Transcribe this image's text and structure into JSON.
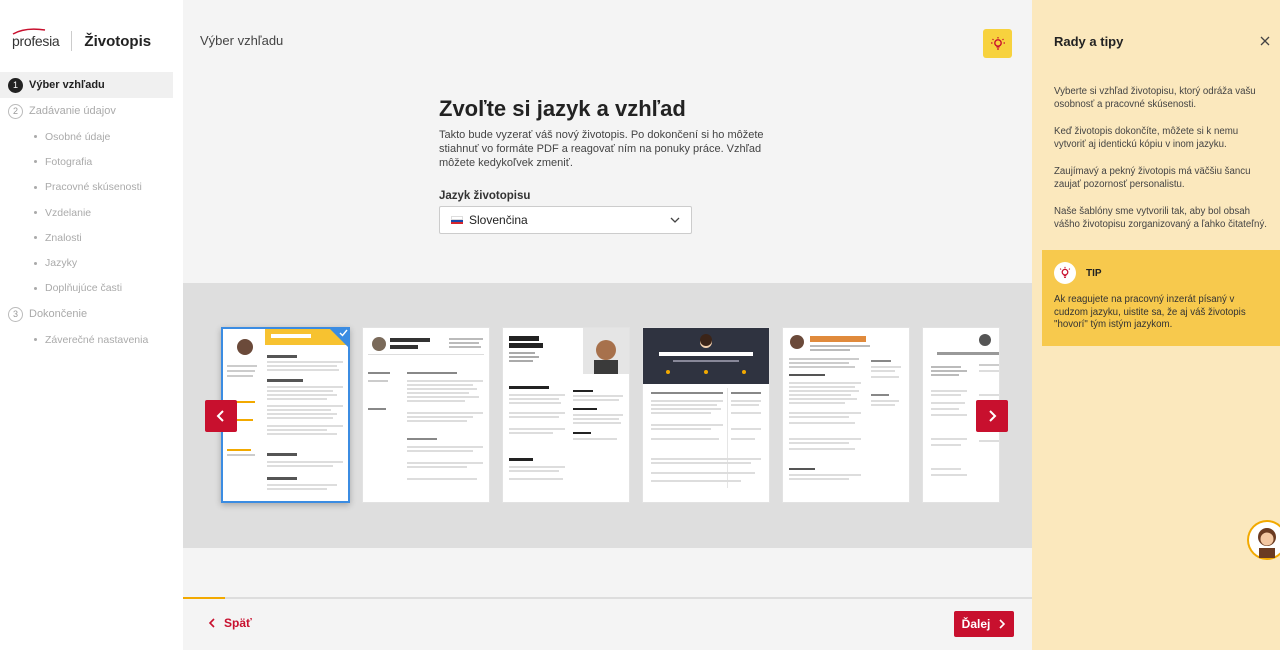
{
  "brand": {
    "logo_text": "profesia",
    "product": "Životopis"
  },
  "sidebar": {
    "steps": [
      {
        "num": "1",
        "label": "Výber vzhľadu",
        "active": true
      },
      {
        "num": "2",
        "label": "Zadávanie údajov",
        "active": false
      },
      {
        "num": "3",
        "label": "Dokončenie",
        "active": false
      }
    ],
    "substeps_data": [
      "Osobné údaje",
      "Fotografia",
      "Pracovné skúsenosti",
      "Vzdelanie",
      "Znalosti",
      "Jazyky",
      "Doplňujúce časti"
    ],
    "substeps_finish": [
      "Záverečné nastavenia"
    ]
  },
  "main": {
    "page_title": "Výber vzhľadu",
    "heading": "Zvoľte si jazyk a vzhľad",
    "description": "Takto bude vyzerať váš nový životopis. Po dokončení si ho môžete stiahnuť vo formáte PDF a reagovať ním na ponuky práce. Vzhľad môžete kedykoľvek zmeniť.",
    "language_label": "Jazyk životopisu",
    "language_value": "Slovenčina",
    "templates": [
      {
        "name": "Ing. Monika Lopúchová",
        "style": "yellow",
        "selected": true
      },
      {
        "name": "ING. MATEJ STRUHÁR",
        "style": "classic",
        "selected": false
      },
      {
        "name": "Ing. MATEJ STRUHÁR",
        "style": "bold",
        "selected": false
      },
      {
        "name": "ING. MONIKA LOPÚCHOVÁ",
        "style": "dark",
        "selected": false
      },
      {
        "name": "Maximilián Ábel",
        "style": "orange",
        "selected": false
      },
      {
        "name": "ING. VLADIMÍR Z",
        "style": "minimal",
        "selected": false
      }
    ],
    "progress": 0.05,
    "back_label": "Späť",
    "next_label": "Ďalej"
  },
  "panel": {
    "title": "Rady a tipy",
    "paragraphs": [
      "Vyberte si vzhľad životopisu, ktorý odráža vašu osobnosť a pracovné skúsenosti.",
      "Keď životopis dokončíte, môžete si k nemu vytvoriť aj identickú kópiu v inom jazyku.",
      "Zaujímavý a pekný životopis má väčšiu šancu zaujať pozornosť personalistu.",
      "Naše šablóny sme vytvorili tak, aby bol obsah vášho životopisu zorganizovaný a ľahko čitateľný."
    ],
    "tip_label": "TIP",
    "tip_text": "Ak reagujete na pracovný inzerát písaný v cudzom jazyku, uistite sa, že aj váš životopis \"hovorí\" tým istým jazykom."
  },
  "colors": {
    "brand_red": "#c8102e",
    "accent_yellow": "#f7d23e",
    "panel_bg": "#fbe8bd",
    "selected_blue": "#3b8ce2"
  }
}
